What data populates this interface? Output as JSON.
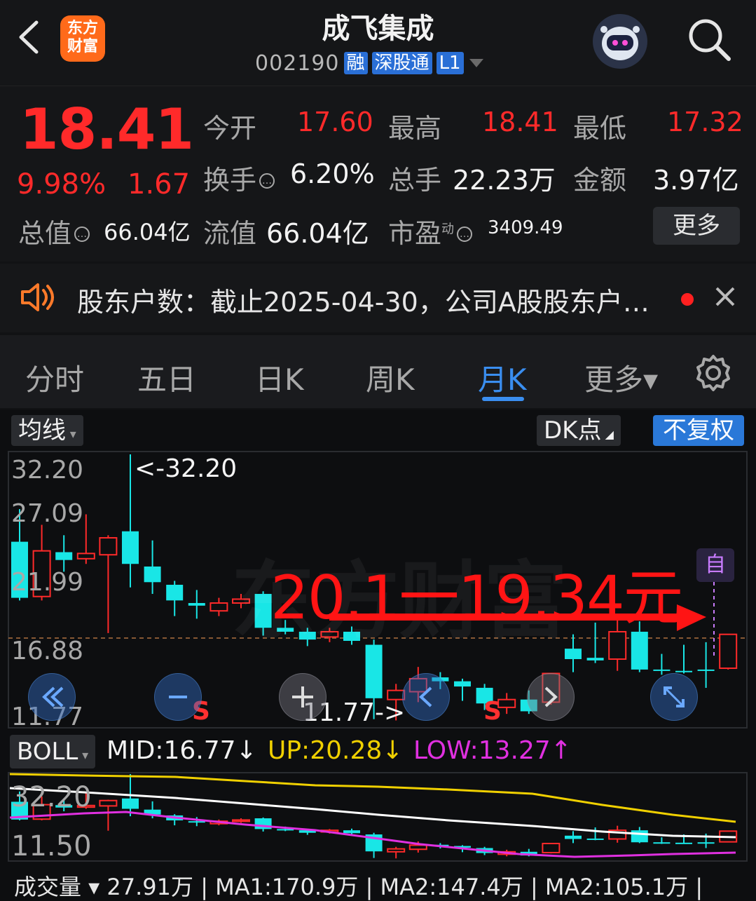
{
  "header": {
    "app_logo": "东方\n财富",
    "stock_name": "成飞集成",
    "stock_code": "002190",
    "tags": [
      "融",
      "深股通",
      "L1"
    ]
  },
  "quote": {
    "price": "18.41",
    "change_pct": "9.98%",
    "change_amt": "1.67",
    "open_label": "今开",
    "open": "17.60",
    "high_label": "最高",
    "high": "18.41",
    "low_label": "最低",
    "low": "17.32",
    "turnover_label": "换手",
    "turnover": "6.20%",
    "volume_label": "总手",
    "volume": "22.23万",
    "amount_label": "金额",
    "amount": "3.97亿",
    "mktcap_label": "总值",
    "mktcap": "66.04亿",
    "float_label": "流值",
    "float_cap": "66.04亿",
    "pe_label": "市盈",
    "pe_sup": "动",
    "pe": "3409.49",
    "more": "更多"
  },
  "news": {
    "text": "股东户数：截止2025-04-30，公司A股股东户…"
  },
  "tabs": [
    {
      "label": "分时"
    },
    {
      "label": "五日"
    },
    {
      "label": "日K"
    },
    {
      "label": "周K"
    },
    {
      "label": "月K"
    },
    {
      "label": "更多▾"
    }
  ],
  "chart_controls": {
    "indicator": "均线",
    "dk": "DK点",
    "adjust": "不复权",
    "zi": "自"
  },
  "main_axis": {
    "labels": [
      "32.20",
      "27.09",
      "21.99",
      "16.88",
      "11.77"
    ],
    "ymin": 11.77,
    "ymax": 32.2
  },
  "annotations": {
    "max_marker": "<-32.20",
    "min_marker": "11.77->",
    "overlay": "20.1一19.34元",
    "signals": [
      "S",
      "S"
    ],
    "watermark": "东方财富"
  },
  "boll": {
    "name": "BOLL",
    "mid": "MID:16.77↓",
    "up": "UP:20.28↓",
    "low": "LOW:13.27↑",
    "axis_top": "32.20",
    "axis_bottom": "11.50",
    "colors": {
      "up": "#f0d000",
      "mid": "#ffffff",
      "low": "#e030e0"
    }
  },
  "volume_bar": {
    "text": "成交量 ▾ 27.91万 | MA1:170.9万 | MA2:147.4万 | MA2:105.1万 |"
  },
  "colors": {
    "up": "#ff2a2a",
    "down": "#19e6e6",
    "accent": "#3a8ef0"
  },
  "chart_data": {
    "type": "candlestick",
    "period": "monthly",
    "ylim": [
      11.77,
      32.2
    ],
    "candles": [
      {
        "o": 25.5,
        "h": 28.0,
        "l": 21.0,
        "c": 21.2
      },
      {
        "o": 21.3,
        "h": 26.8,
        "l": 21.0,
        "c": 24.8
      },
      {
        "o": 24.7,
        "h": 26.0,
        "l": 23.2,
        "c": 24.1
      },
      {
        "o": 24.2,
        "h": 27.6,
        "l": 23.8,
        "c": 24.6
      },
      {
        "o": 24.5,
        "h": 26.0,
        "l": 18.5,
        "c": 25.8
      },
      {
        "o": 26.3,
        "h": 32.2,
        "l": 22.0,
        "c": 23.8
      },
      {
        "o": 23.6,
        "h": 25.6,
        "l": 21.5,
        "c": 22.4
      },
      {
        "o": 22.2,
        "h": 22.5,
        "l": 19.8,
        "c": 21.0
      },
      {
        "o": 20.8,
        "h": 21.8,
        "l": 19.6,
        "c": 20.6
      },
      {
        "o": 20.2,
        "h": 21.2,
        "l": 19.8,
        "c": 20.8
      },
      {
        "o": 20.8,
        "h": 21.5,
        "l": 20.4,
        "c": 21.1
      },
      {
        "o": 21.5,
        "h": 21.7,
        "l": 18.3,
        "c": 18.9
      },
      {
        "o": 18.9,
        "h": 19.5,
        "l": 18.4,
        "c": 18.6
      },
      {
        "o": 18.6,
        "h": 18.9,
        "l": 17.5,
        "c": 18.0
      },
      {
        "o": 18.2,
        "h": 18.9,
        "l": 17.8,
        "c": 18.6
      },
      {
        "o": 18.6,
        "h": 19.0,
        "l": 17.6,
        "c": 17.9
      },
      {
        "o": 17.6,
        "h": 18.0,
        "l": 11.9,
        "c": 13.5
      },
      {
        "o": 13.4,
        "h": 14.6,
        "l": 11.8,
        "c": 14.1
      },
      {
        "o": 14.0,
        "h": 15.9,
        "l": 13.2,
        "c": 15.0
      },
      {
        "o": 15.1,
        "h": 15.5,
        "l": 14.2,
        "c": 14.8
      },
      {
        "o": 14.8,
        "h": 15.0,
        "l": 13.3,
        "c": 14.4
      },
      {
        "o": 14.3,
        "h": 14.6,
        "l": 12.6,
        "c": 13.1
      },
      {
        "o": 12.8,
        "h": 13.9,
        "l": 12.3,
        "c": 13.4
      },
      {
        "o": 13.4,
        "h": 14.1,
        "l": 12.3,
        "c": 12.5
      },
      {
        "o": 13.2,
        "h": 15.4,
        "l": 13.0,
        "c": 15.4
      },
      {
        "o": 17.3,
        "h": 18.4,
        "l": 15.5,
        "c": 16.5
      },
      {
        "o": 16.6,
        "h": 19.3,
        "l": 16.2,
        "c": 16.4
      },
      {
        "o": 16.5,
        "h": 19.7,
        "l": 15.6,
        "c": 18.6
      },
      {
        "o": 18.6,
        "h": 19.4,
        "l": 15.5,
        "c": 15.7
      },
      {
        "o": 15.7,
        "h": 16.9,
        "l": 15.3,
        "c": 15.6
      },
      {
        "o": 15.6,
        "h": 17.6,
        "l": 15.4,
        "c": 15.5
      },
      {
        "o": 15.7,
        "h": 17.8,
        "l": 14.3,
        "c": 15.6
      },
      {
        "o": 15.8,
        "h": 18.4,
        "l": 15.7,
        "c": 18.4
      }
    ]
  }
}
